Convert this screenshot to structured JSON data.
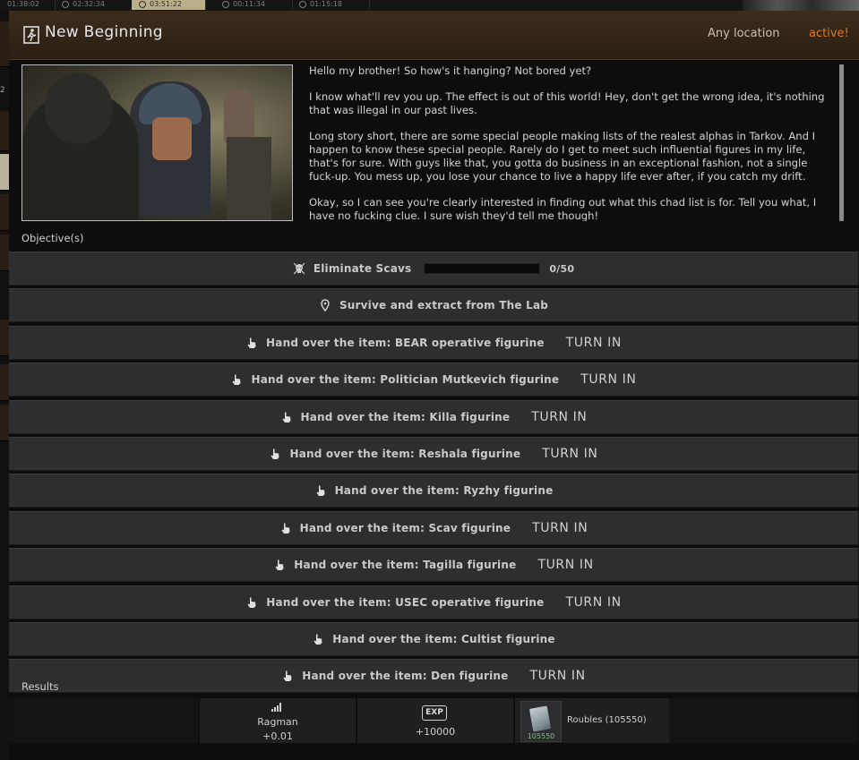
{
  "topbar": {
    "timers": [
      "01:38:02",
      "02:32:34",
      "03:51:22",
      "00:11:34",
      "01:15:18"
    ],
    "active_index": 2
  },
  "sidebar": {
    "number": "2"
  },
  "quest": {
    "title": "New Beginning",
    "location": "Any location",
    "status": "active!",
    "status_color": "#d77a2c",
    "description": [
      "Hello my brother! So how's it hanging? Not bored yet?",
      "I know what'll rev you up. The effect is out of this world! Hey, don't get the wrong idea, it's nothing that was illegal in our past lives.",
      "Long story short, there are some special people making lists of the realest alphas in Tarkov. And I happen to know these special people. Rarely do I get to meet such influential figures in my life, that's for sure. With guys like that, you gotta do business in an exceptional fashion, not a single fuck-up. You mess up, you lose your chance to live a happy life ever after, if you catch my drift.",
      "Okay, so I can see you're clearly interested in finding out what this chad list is for. Tell you what, I have no fucking clue. I sure wish they'd tell me though!"
    ]
  },
  "objectives_label": "Objective(s)",
  "objectives": [
    {
      "icon": "skull-icon",
      "text": "Eliminate Scavs",
      "progress": {
        "current": 0,
        "total": 50,
        "label": "0/50"
      }
    },
    {
      "icon": "location-pin-icon",
      "text": "Survive and extract from The Lab"
    },
    {
      "icon": "hand-pointer-icon",
      "text": "Hand over the item: BEAR operative figurine",
      "action": "TURN IN"
    },
    {
      "icon": "hand-pointer-icon",
      "text": "Hand over the item: Politician Mutkevich figurine",
      "action": "TURN IN"
    },
    {
      "icon": "hand-pointer-icon",
      "text": "Hand over the item: Killa figurine",
      "action": "TURN IN"
    },
    {
      "icon": "hand-pointer-icon",
      "text": "Hand over the item: Reshala figurine",
      "action": "TURN IN"
    },
    {
      "icon": "hand-pointer-icon",
      "text": "Hand over the item: Ryzhy figurine"
    },
    {
      "icon": "hand-pointer-icon",
      "text": "Hand over the item: Scav figurine",
      "action": "TURN IN"
    },
    {
      "icon": "hand-pointer-icon",
      "text": "Hand over the item: Tagilla figurine",
      "action": "TURN IN"
    },
    {
      "icon": "hand-pointer-icon",
      "text": "Hand over the item: USEC operative figurine",
      "action": "TURN IN"
    },
    {
      "icon": "hand-pointer-icon",
      "text": "Hand over the item: Cultist figurine"
    },
    {
      "icon": "hand-pointer-icon",
      "text": "Hand over the item: Den figurine",
      "action": "TURN IN"
    }
  ],
  "results_label": "Results",
  "results": {
    "rep": {
      "icon": "rep-bars-icon",
      "trader": "Ragman",
      "value": "+0.01"
    },
    "exp": {
      "icon_text": "EXP",
      "value": "+10000"
    },
    "item": {
      "name": "Roubles (105550)",
      "quantity": "105550"
    }
  }
}
